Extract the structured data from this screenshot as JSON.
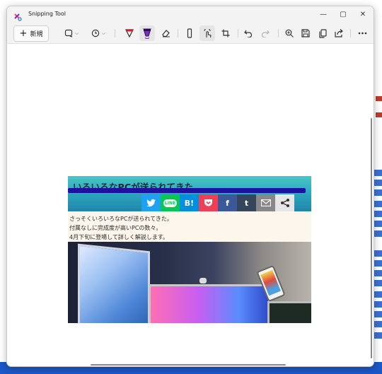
{
  "window": {
    "app_title": "Snipping Tool",
    "controls": {
      "minimize": "—",
      "maximize": "▢",
      "close": "✕"
    }
  },
  "toolbar": {
    "new_label": "新規",
    "icons": [
      "snip-mode-icon",
      "timer-icon",
      "ballpoint-pen-icon",
      "highlighter-icon",
      "eraser-icon",
      "ruler-icon",
      "touch-writing-icon",
      "crop-icon",
      "undo-icon",
      "redo-icon",
      "zoom-in-icon",
      "save-icon",
      "copy-icon",
      "share-icon",
      "more-icon"
    ]
  },
  "capture": {
    "banner_title": "いろいろなPCが送られてきた",
    "share_buttons": [
      {
        "name": "twitter",
        "label": "",
        "color": "#1da1f2"
      },
      {
        "name": "line",
        "label": "LINE",
        "color": "#06c755"
      },
      {
        "name": "hatena",
        "label": "B!",
        "color": "#008fde"
      },
      {
        "name": "pocket",
        "label": "",
        "color": "#ef3f56"
      },
      {
        "name": "facebook",
        "label": "f",
        "color": "#3b5998"
      },
      {
        "name": "tumblr",
        "label": "t",
        "color": "#35465c"
      },
      {
        "name": "mail",
        "label": "",
        "color": "#888888"
      },
      {
        "name": "share",
        "label": "",
        "color": "#e6e6e6"
      }
    ],
    "body_lines": [
      "さっそくいろいろなPCが送られてきた。",
      "付属なしに完成度が高いPCの数々。",
      "4月下旬に登場して詳しく解説します。"
    ]
  },
  "colors": {
    "accent": "#7d2ac7",
    "pen_stroke": "#1b139c",
    "title_bar": "#f3f3f3"
  }
}
